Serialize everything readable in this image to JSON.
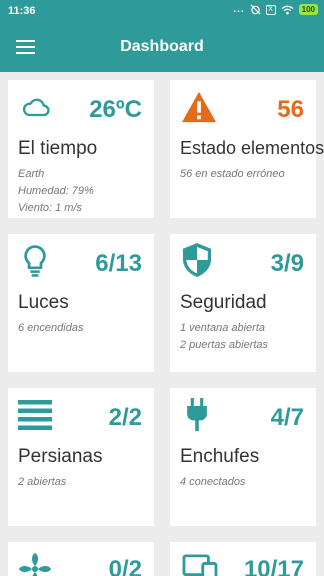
{
  "status_bar": {
    "time": "11:36",
    "dots": "...",
    "x_label": "X",
    "battery": "100"
  },
  "header": {
    "title": "Dashboard"
  },
  "cards": [
    {
      "title": "El tiempo",
      "value": "26ºC",
      "icon": "cloud-icon",
      "lines": [
        "Earth",
        "Humedad: 79%",
        "Viento: 1 m/s"
      ]
    },
    {
      "title": "Estado elementos",
      "value": "56",
      "icon": "warning-icon",
      "lines": [
        "56 en estado erróneo"
      ]
    },
    {
      "title": "Luces",
      "value": "6/13",
      "icon": "lightbulb-icon",
      "lines": [
        "6 encendidas"
      ]
    },
    {
      "title": "Seguridad",
      "value": "3/9",
      "icon": "shield-icon",
      "lines": [
        "1 ventana abierta",
        "2 puertas abiertas"
      ]
    },
    {
      "title": "Persianas",
      "value": "2/2",
      "icon": "blinds-icon",
      "lines": [
        "2 abiertas"
      ]
    },
    {
      "title": "Enchufes",
      "value": "4/7",
      "icon": "plug-icon",
      "lines": [
        "4 conectados"
      ]
    },
    {
      "title": "",
      "value": "0/2",
      "icon": "fan-icon",
      "lines": []
    },
    {
      "title": "",
      "value": "10/17",
      "icon": "devices-icon",
      "lines": []
    }
  ],
  "colors": {
    "primary": "#2e9b9a",
    "warning": "#e46b19",
    "background": "#ececec"
  }
}
